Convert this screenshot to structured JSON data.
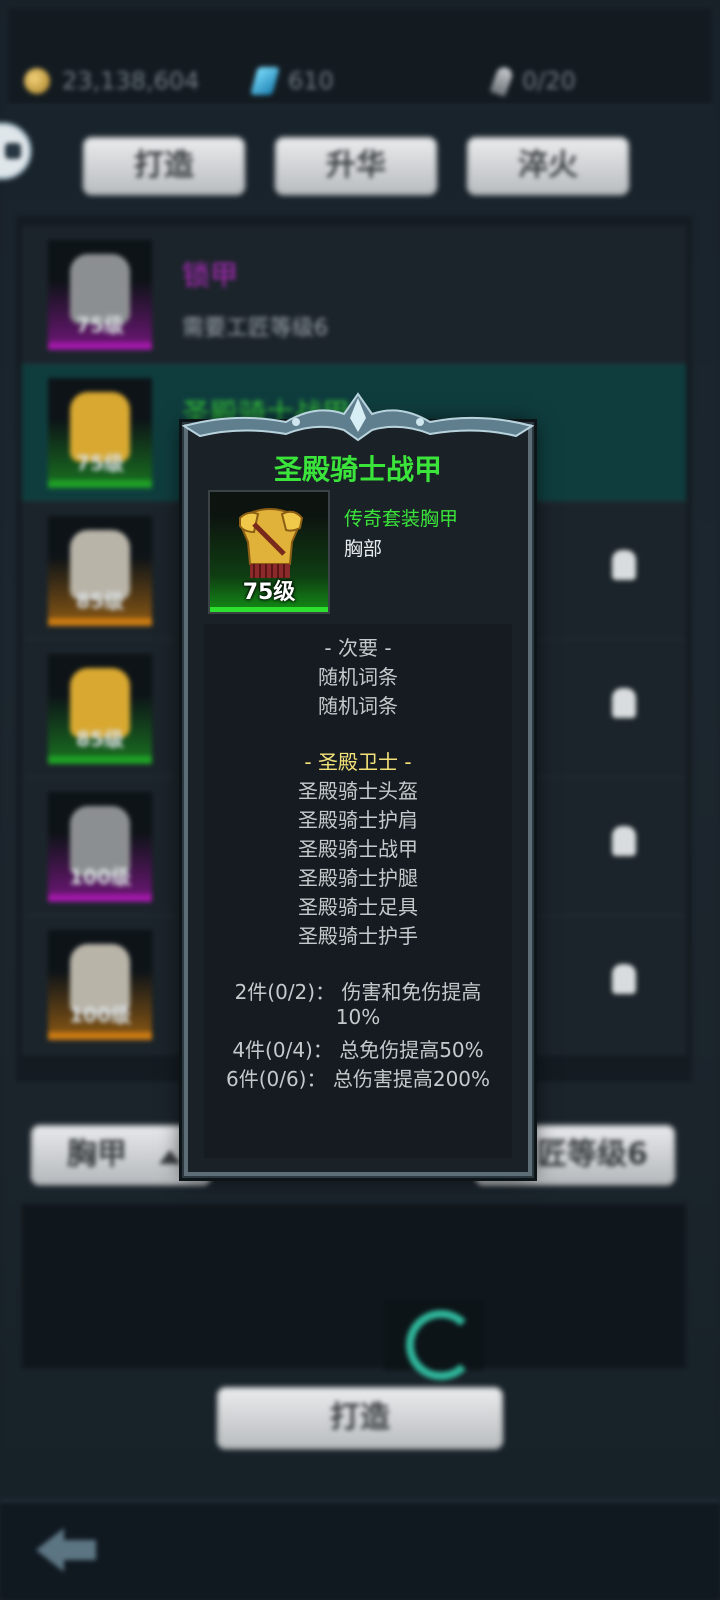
{
  "resources": {
    "gold": "23,138,604",
    "gems": "610",
    "feathers": "0/20"
  },
  "tabs": [
    "打造",
    "升华",
    "淬火"
  ],
  "list": [
    {
      "level": "75级",
      "title": "锁甲",
      "subtitle": "需要工匠等级6",
      "rarity_color": "#a018a8",
      "title_color": "#b52ac2",
      "selected": false,
      "locked": false
    },
    {
      "level": "75级",
      "title": "圣殿骑士战甲",
      "subtitle": "",
      "rarity_color": "#1fa025",
      "title_color": "#36c43a",
      "selected": true,
      "locked": false
    },
    {
      "level": "85级",
      "title": "",
      "subtitle": "",
      "rarity_color": "#c97a12",
      "title_color": "#c98a30",
      "selected": false,
      "locked": true
    },
    {
      "level": "85级",
      "title": "",
      "subtitle": "",
      "rarity_color": "#1fa025",
      "title_color": "#36c43a",
      "selected": false,
      "locked": true
    },
    {
      "level": "100级",
      "title": "",
      "subtitle": "",
      "rarity_color": "#a018a8",
      "title_color": "#b52ac2",
      "selected": false,
      "locked": true
    },
    {
      "level": "100级",
      "title": "",
      "subtitle": "",
      "rarity_color": "#c97a12",
      "title_color": "#c98a30",
      "selected": false,
      "locked": true
    }
  ],
  "filters": {
    "slot_label": "胸甲",
    "craft_level_label": "匠等级6"
  },
  "craft_button": "打造",
  "tooltip": {
    "title": "圣殿骑士战甲",
    "type": "传奇套装胸甲",
    "slot": "胸部",
    "level": "75级",
    "secondary_header": "-  次要  -",
    "secondary_lines": [
      "随机词条",
      "随机词条"
    ],
    "set_header": "-  圣殿卫士  -",
    "set_items": [
      "圣殿骑士头盔",
      "圣殿骑士护肩",
      "圣殿骑士战甲",
      "圣殿骑士护腿",
      "圣殿骑士足具",
      "圣殿骑士护手"
    ],
    "set_bonuses": [
      "2件(0/2)：  伤害和免伤提高",
      "10%",
      "4件(0/4)：  总免伤提高50%",
      "6件(0/6)：  总伤害提高200%"
    ]
  },
  "colors": {
    "title_green": "#3ae43a",
    "set_gold": "#f3e27a"
  }
}
